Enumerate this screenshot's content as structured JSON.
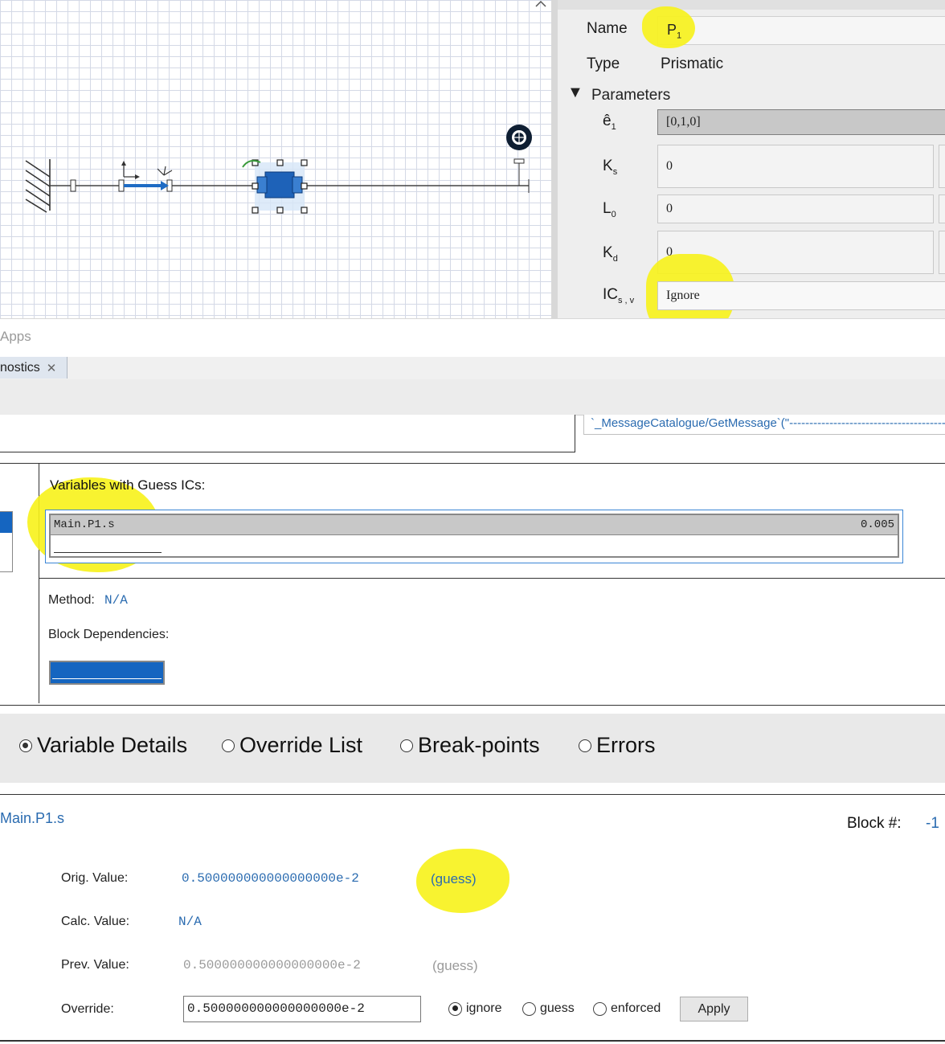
{
  "inspector": {
    "name_label": "Name",
    "name_value_main": "P",
    "name_value_sub": "1",
    "type_label": "Type",
    "type_value": "Prismatic",
    "parameters_label": "Parameters",
    "params": [
      {
        "symbol": "ê",
        "sub": "1",
        "value": "[0,1,0]"
      },
      {
        "symbol": "K",
        "sub": "s",
        "value": "0"
      },
      {
        "symbol": "L",
        "sub": "0",
        "value": "0"
      },
      {
        "symbol": "K",
        "sub": "d",
        "value": "0"
      },
      {
        "symbol": "IC",
        "sub": "s , v",
        "value": "Ignore"
      }
    ]
  },
  "apps_label": "Apps",
  "tabs": {
    "diagnostics_label": "nostics",
    "close_glyph": "✕"
  },
  "message_text": "`_MessageCatalogue/GetMessage`(\"--------------------------------------------",
  "guess_panel": {
    "title": "Variables with Guess ICs:",
    "rows": [
      {
        "name": "Main.P1.s",
        "value": "0.005"
      }
    ],
    "method_label": "Method:",
    "method_value": "N/A",
    "block_deps_label": "Block Dependencies:"
  },
  "view_options": {
    "items": [
      {
        "label": "Variable Details",
        "selected": true
      },
      {
        "label": "Override List",
        "selected": false
      },
      {
        "label": "Break-points",
        "selected": false
      },
      {
        "label": "Errors",
        "selected": false
      }
    ]
  },
  "details": {
    "variable_name": "Main.P1.s",
    "block_label": "Block #:",
    "block_value": "-1",
    "orig_label": "Orig. Value:",
    "orig_value": "0.500000000000000000e-2",
    "orig_tag": "(guess)",
    "calc_label": "Calc. Value:",
    "calc_value": "N/A",
    "prev_label": "Prev. Value:",
    "prev_value": "0.500000000000000000e-2",
    "prev_tag": "(guess)",
    "override_label": "Override:",
    "override_value": "0.500000000000000000e-2",
    "override_options": [
      {
        "label": "ignore",
        "selected": true
      },
      {
        "label": "guess",
        "selected": false
      },
      {
        "label": "enforced",
        "selected": false
      }
    ],
    "apply_label": "Apply"
  },
  "colors": {
    "highlight": "#f7f21a",
    "link_blue": "#2a6bb0",
    "selection_blue": "#1565c0"
  }
}
